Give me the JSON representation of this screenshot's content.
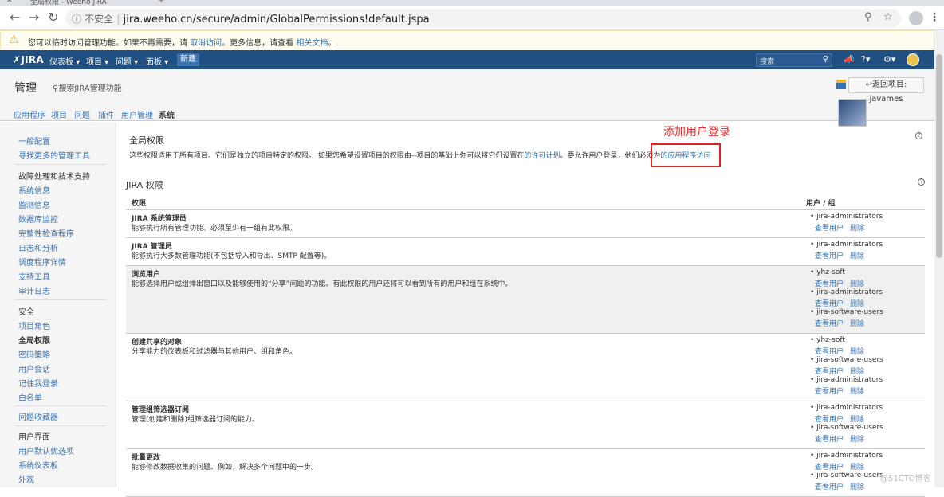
{
  "browser": {
    "tab_title": "全局权限 - Weeho JIRA",
    "security_label": "不安全",
    "url": "jira.weeho.cn/secure/admin/GlobalPermissions!default.jspa"
  },
  "warning": {
    "text_before": "您可以临时访问管理功能。如果不再需要，请",
    "link1": "取消访问",
    "text_mid": "。更多信息，请查看",
    "link2": "相关文档",
    "text_after": "。."
  },
  "header": {
    "logo": "JIRA",
    "nav": [
      "仪表板 ▾",
      "项目 ▾",
      "问题 ▾",
      "面板 ▾"
    ],
    "create": "新建",
    "search_placeholder": "搜索"
  },
  "admin": {
    "title": "管理",
    "search_label": "搜索JIRA管理功能",
    "back_button": "↩返回项目: javames"
  },
  "tabs": [
    "应用程序",
    "项目",
    "问题",
    "插件",
    "用户管理",
    "系统"
  ],
  "sidebar": {
    "g1": [
      "一般配置",
      "寻找更多的管理工具"
    ],
    "h2": "故障处理和技术支持",
    "g2": [
      "系统信息",
      "监测信息",
      "数据库监控",
      "完整性检查程序",
      "日志和分析",
      "调度程序详情",
      "支持工具",
      "审计日志"
    ],
    "h3": "安全",
    "g3": [
      "项目角色",
      "全局权限",
      "密码策略",
      "用户会话",
      "记住我登录",
      "白名单"
    ],
    "g4": [
      "问题收藏器"
    ],
    "h5": "用户界面",
    "g5": [
      "用户默认优选项",
      "系统仪表板",
      "外观"
    ]
  },
  "global": {
    "title": "全局权限",
    "desc": "这些权限适用于所有项目。它们是独立的项目特定的权限。 如果您希望设置项目的权限由--项目的基础上你可以将它们设置在",
    "link1": "的许可计划",
    "desc2": "。要允许用户登录，他们必须为",
    "link2": "的应用程序访问"
  },
  "annotation": "添加用户登录",
  "jira": {
    "title": "JIRA 权限",
    "col_perm": "权限",
    "col_users": "用户 / 组",
    "view_label": "查看用户",
    "remove_label": "删除",
    "rows": [
      {
        "name": "JIRA 系统管理员",
        "desc": "能够执行所有管理功能。必须至少有一组有此权限。",
        "groups": [
          "jira-administrators"
        ]
      },
      {
        "name": "JIRA 管理员",
        "desc": "能够执行大多数管理功能(不包括导入和导出、SMTP 配置等)。",
        "groups": [
          "jira-administrators"
        ]
      },
      {
        "name": "浏览用户",
        "desc": "能够选择用户或组弹出窗口以及能够使用的“分享”问题的功能。有此权限的用户还将可以看到所有的用户和组在系统中。",
        "groups": [
          "yhz-soft",
          "jira-administrators",
          "jira-software-users"
        ]
      },
      {
        "name": "创建共享的对象",
        "desc": "分享能力的仪表板和过滤器与其他用户、组和角色。",
        "groups": [
          "yhz-soft",
          "jira-software-users",
          "jira-administrators"
        ]
      },
      {
        "name": "管理组筛选器订阅",
        "desc": "管理(创建和删除)组筛选器订阅的能力。",
        "groups": [
          "jira-administrators",
          "jira-software-users"
        ]
      },
      {
        "name": "批量更改",
        "desc": "能够修改数据收集的问题。例如，解决多个问题中的一步。",
        "groups": [
          "jira-administrators",
          "jira-software-users"
        ]
      }
    ]
  },
  "watermark": "@51CTO博客"
}
